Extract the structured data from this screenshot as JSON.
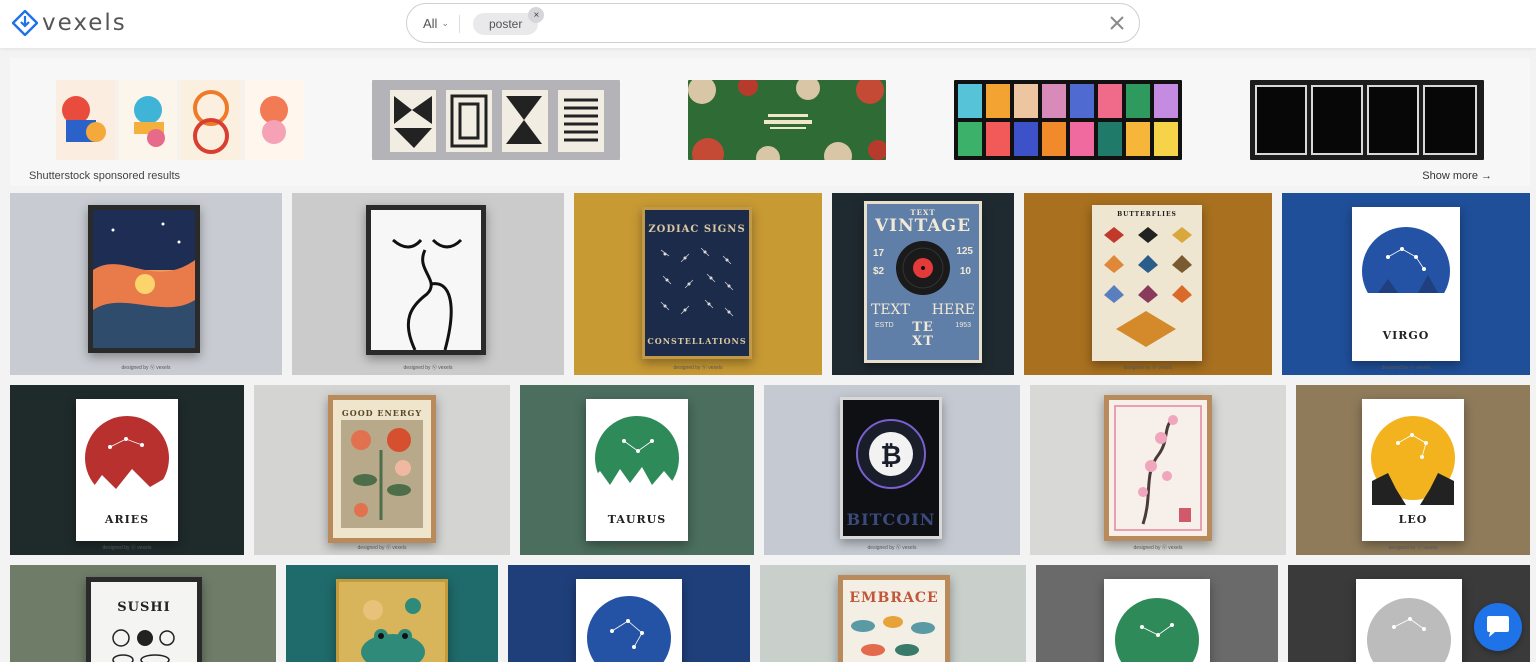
{
  "header": {
    "logo_text": "vexels",
    "search": {
      "scope": "All",
      "chip": "poster"
    }
  },
  "sponsored": {
    "label": "Shutterstock sponsored results",
    "show_more": "Show more →"
  },
  "posters": {
    "zodiac_title": "ZODIAC SIGNS",
    "constellations": "CONSTELLATIONS",
    "vintage": "VINTAGE",
    "text_top": "TEXT",
    "text_here_left": "TEXT",
    "text_here_right": "HERE",
    "te": "TE",
    "xt": "XT",
    "n17": "17",
    "n125": "125",
    "s2": "$2",
    "n10": "10",
    "estd": "ESTD",
    "y1953": "1953",
    "butterflies": "BUTTERFLIES",
    "virgo": "VIRGO",
    "aries": "ARIES",
    "good_energy": "GOOD ENERGY",
    "taurus": "TAURUS",
    "bitcoin": "BITCOIN",
    "leo": "LEO",
    "sushi": "SUSHI",
    "embrace": "EMBRACE",
    "designed_by": "designed by Ⓥ vexels"
  },
  "colors": {
    "brand_blue": "#1e73e8",
    "page_bg": "#f3f3f4"
  }
}
